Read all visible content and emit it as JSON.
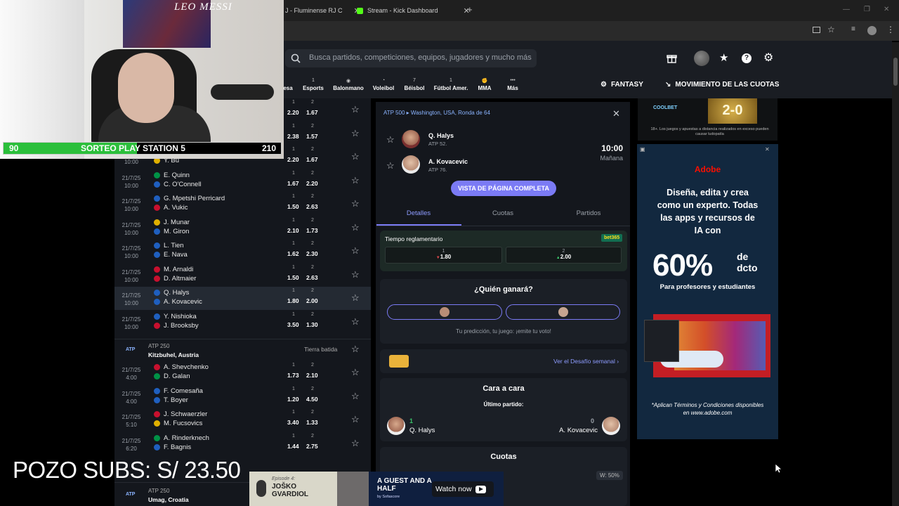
{
  "browser": {
    "tabs": [
      {
        "label": "J - Fluminense RJ C"
      },
      {
        "label": "Stream - Kick Dashboard"
      }
    ],
    "new_tab": "+"
  },
  "webcam": {
    "poster_text": "LEO MESSI",
    "giveaway_left": "90",
    "giveaway_title": "SORTEO PLAY STATION 5",
    "giveaway_right": "210"
  },
  "overlay": {
    "pozo_text": "POZO SUBS: S/ 23.50"
  },
  "header": {
    "search_placeholder": "Busca partidos, competiciones, equipos, jugadores y mucho más",
    "sports": [
      {
        "label": "esa",
        "count": ""
      },
      {
        "label": "Esports",
        "count": "1"
      },
      {
        "label": "Balonmano",
        "count": ""
      },
      {
        "label": "Voleibol",
        "count": ""
      },
      {
        "label": "Béisbol",
        "count": "7"
      },
      {
        "label": "Fútbol Amer.",
        "count": "1"
      },
      {
        "label": "MMA",
        "count": ""
      },
      {
        "label": "Más",
        "count": ""
      }
    ],
    "fantasy": "FANTASY",
    "odds_movement": "MOVIMIENTO DE LAS CUOTAS"
  },
  "matches": [
    {
      "date": "",
      "time": "",
      "p1": "",
      "p2": "",
      "o1": "2.20",
      "o2": "1.67"
    },
    {
      "date": "",
      "time": "",
      "p1": "",
      "p2": "",
      "o1": "2.38",
      "o2": "1.57"
    },
    {
      "date": "",
      "time": "10:00",
      "p1": "",
      "p2": "Y. Bu",
      "o1": "2.20",
      "o2": "1.67"
    },
    {
      "date": "21/7/25",
      "time": "10:00",
      "p1": "E. Quinn",
      "p2": "C. O'Connell",
      "o1": "1.67",
      "o2": "2.20"
    },
    {
      "date": "21/7/25",
      "time": "10:00",
      "p1": "G. Mpetshi Perricard",
      "p2": "A. Vukic",
      "o1": "1.50",
      "o2": "2.63"
    },
    {
      "date": "21/7/25",
      "time": "10:00",
      "p1": "J. Munar",
      "p2": "M. Giron",
      "o1": "2.10",
      "o2": "1.73"
    },
    {
      "date": "21/7/25",
      "time": "10:00",
      "p1": "L. Tien",
      "p2": "E. Nava",
      "o1": "1.62",
      "o2": "2.30"
    },
    {
      "date": "21/7/25",
      "time": "10:00",
      "p1": "M. Arnaldi",
      "p2": "D. Altmaier",
      "o1": "1.50",
      "o2": "2.63"
    },
    {
      "date": "21/7/25",
      "time": "10:00",
      "p1": "Q. Halys",
      "p2": "A. Kovacevic",
      "o1": "1.80",
      "o2": "2.00"
    },
    {
      "date": "21/7/25",
      "time": "10:00",
      "p1": "Y. Nishioka",
      "p2": "J. Brooksby",
      "o1": "3.50",
      "o2": "1.30"
    }
  ],
  "tournament2": {
    "name": "ATP 250",
    "location": "Kitzbuhel, Austria",
    "surface": "Tierra batida"
  },
  "matches2": [
    {
      "date": "21/7/25",
      "time": "4:00",
      "p1": "A. Shevchenko",
      "p2": "D. Galan",
      "o1": "1.73",
      "o2": "2.10"
    },
    {
      "date": "21/7/25",
      "time": "4:00",
      "p1": "F. Comesaña",
      "p2": "T. Boyer",
      "o1": "1.20",
      "o2": "4.50"
    },
    {
      "date": "21/7/25",
      "time": "5:10",
      "p1": "J. Schwaerzler",
      "p2": "M. Fucsovics",
      "o1": "3.40",
      "o2": "1.33"
    },
    {
      "date": "21/7/25",
      "time": "6:20",
      "p1": "A. Rinderknech",
      "p2": "F. Bagnis",
      "o1": "1.44",
      "o2": "2.75"
    }
  ],
  "tournament3": {
    "name": "ATP 250",
    "location": "Umag, Croatia"
  },
  "odds_head": {
    "h1": "1",
    "h2": "2"
  },
  "detail": {
    "breadcrumb": "ATP 500 ▸ Washington, USA, Ronda de 64",
    "player1": {
      "name": "Q. Halys",
      "rank": "ATP 52."
    },
    "player2": {
      "name": "A. Kovacevic",
      "rank": "ATP 76."
    },
    "time": "10:00",
    "day": "Mañana",
    "full_page_button": "VISTA DE PÁGINA COMPLETA",
    "tabs": [
      "Detalles",
      "Cuotas",
      "Partidos"
    ],
    "market": "Tiempo reglamentario",
    "bookmaker": "bet365",
    "odd1_label": "1",
    "odd1": "1.80",
    "odd2_label": "2",
    "odd2": "2.00",
    "who_wins": "¿Quién ganará?",
    "vote_hint": "Tu predicción, tu juego: ¡emite tu voto!",
    "weekly_challenge": "Ver el Desafío semanal",
    "h2h_title": "Cara a cara",
    "last_match": "Último partido:",
    "h2h_p1_score": "1",
    "h2h_p1": "Q. Halys",
    "h2h_p2_score": "0",
    "h2h_p2": "A. Kovacevic",
    "odds_title": "Cuotas",
    "win_pct": "W: 50%"
  },
  "ads": {
    "top_brand": "COOLBET",
    "top_badge": "2-0",
    "top_disclaimer": "18+. Los juegos y apuestas a distancia realizados en exceso pueden causar ludopatía",
    "brand": "Adobe",
    "headline": "Diseña, edita y crea como un experto. Todas las apps y recursos de IA con",
    "discount": "60%",
    "discount_suffix": "de dcto",
    "audience": "Para profesores y estudiantes",
    "legal": "*Aplican Términos y Condiciones disponibles en www.adobe.com"
  },
  "banner": {
    "episode": "Episode 4:",
    "guest": "JOŠKO GVARDIOL",
    "title": "A GUEST AND A HALF",
    "by": "by Sofascore",
    "cta": "Watch now"
  },
  "colors": {
    "accent": "#7b7bf5",
    "odds_up": "#3ac36a",
    "odds_down": "#e0474c",
    "green": "#2bbf3b"
  }
}
